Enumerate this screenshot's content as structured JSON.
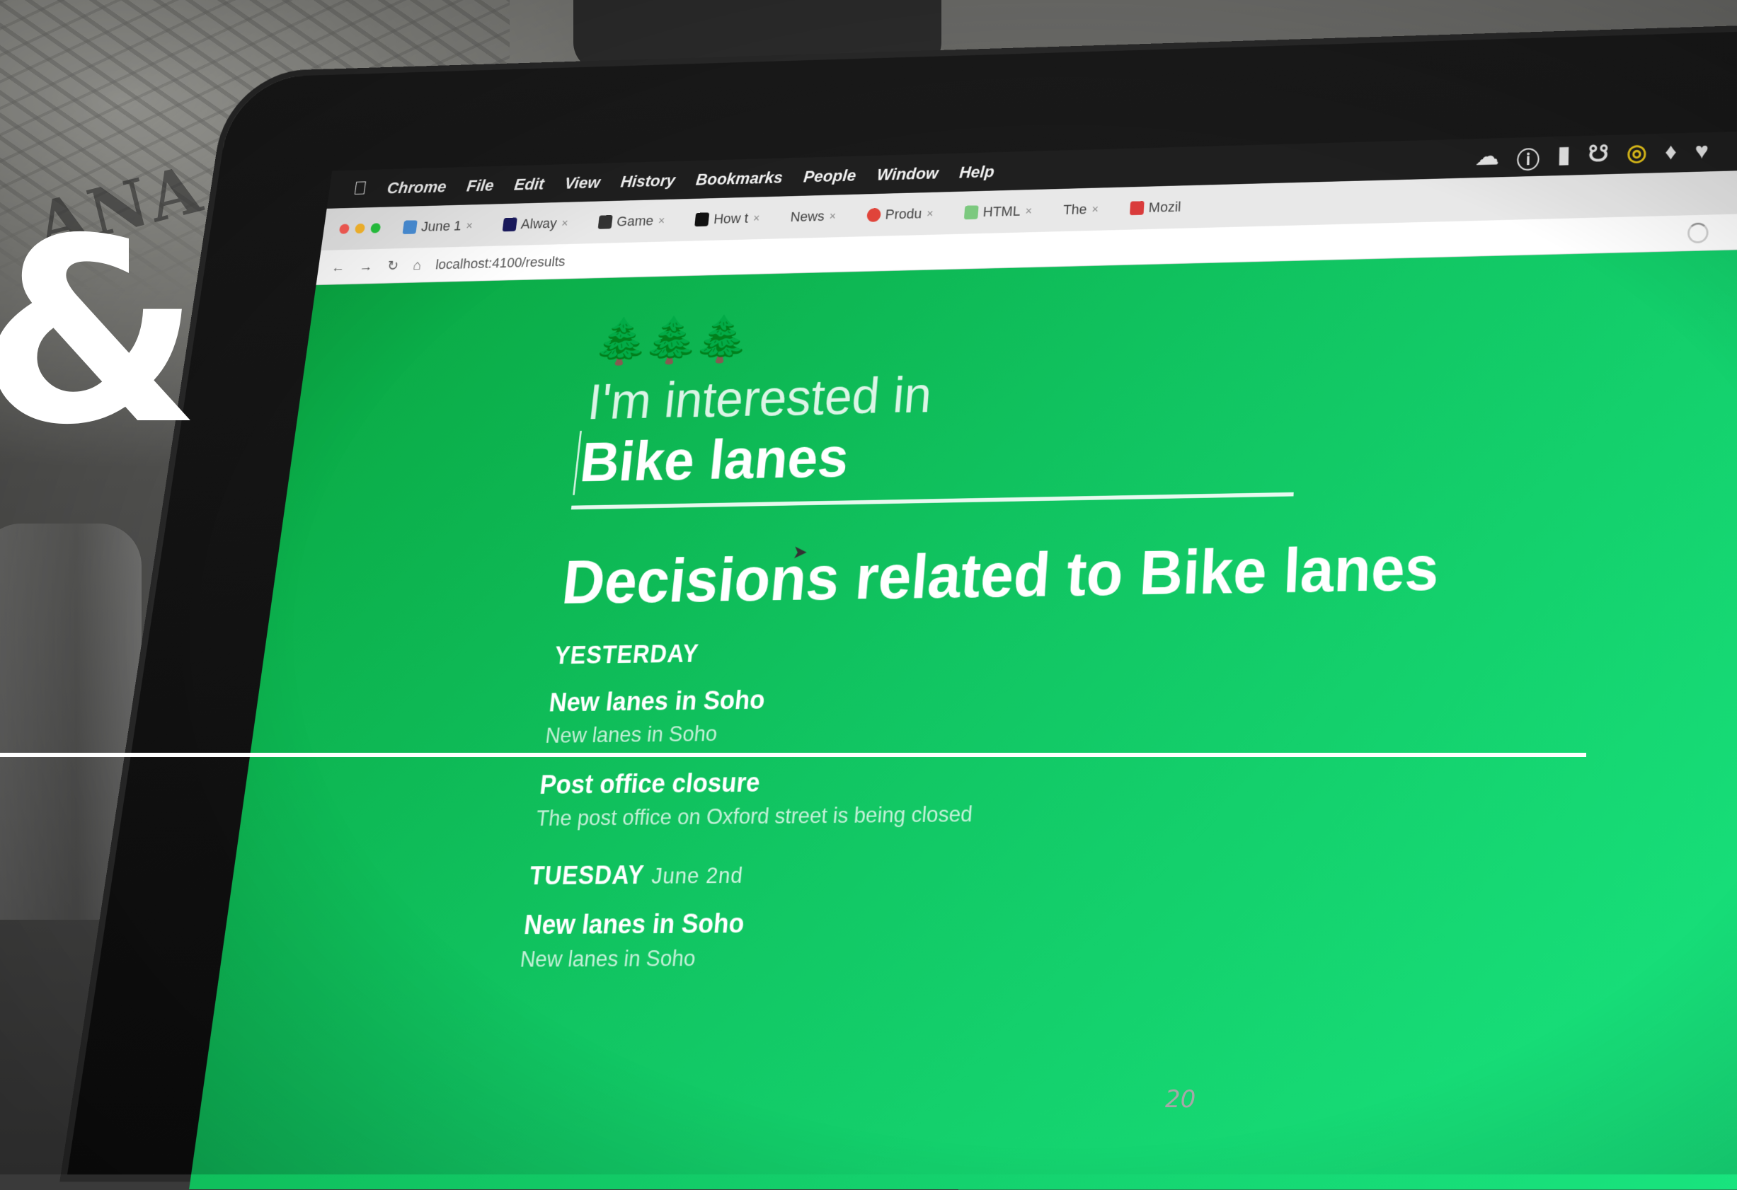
{
  "shirt_text": "ANA COLT",
  "menubar": {
    "items": [
      "Chrome",
      "File",
      "Edit",
      "View",
      "History",
      "Bookmarks",
      "People",
      "Window",
      "Help"
    ],
    "status_icons": [
      "cloud-icon",
      "info-icon",
      "signal-icon",
      "antenna-icon",
      "circle-icon",
      "bell-icon",
      "shield-icon"
    ]
  },
  "tabs": [
    {
      "label": "June 1",
      "color": "#4a90d9"
    },
    {
      "label": "Alway",
      "color": "#1a1a5e"
    },
    {
      "label": "Game",
      "color": "#333333"
    },
    {
      "label": "How t",
      "color": "#111111"
    },
    {
      "label": "News",
      "color": "#cccccc"
    },
    {
      "label": "Produ",
      "color": "#e0443a"
    },
    {
      "label": "HTML",
      "color": "#7cc97f"
    },
    {
      "label": "The",
      "color": "#dddddd"
    },
    {
      "label": "Mozil",
      "color": "#d93b3b"
    }
  ],
  "address": {
    "url": "localhost:4100/results"
  },
  "app": {
    "interested_label": "I'm interested in",
    "topic": "Bike lanes",
    "decisions_heading": "Decisions related to Bike lanes",
    "days": [
      {
        "label": "YESTERDAY",
        "date": "",
        "items": [
          {
            "title": "New lanes in Soho",
            "description": "New lanes in Soho"
          },
          {
            "title": "Post office closure",
            "description": "The post office on Oxford street is being closed"
          }
        ]
      },
      {
        "label": "TUESDAY",
        "date": "June 2nd",
        "items": [
          {
            "title": "New lanes in Soho",
            "description": "New lanes in Soho"
          }
        ]
      }
    ]
  },
  "slide": {
    "ampersand": "&",
    "page_number": "20"
  }
}
